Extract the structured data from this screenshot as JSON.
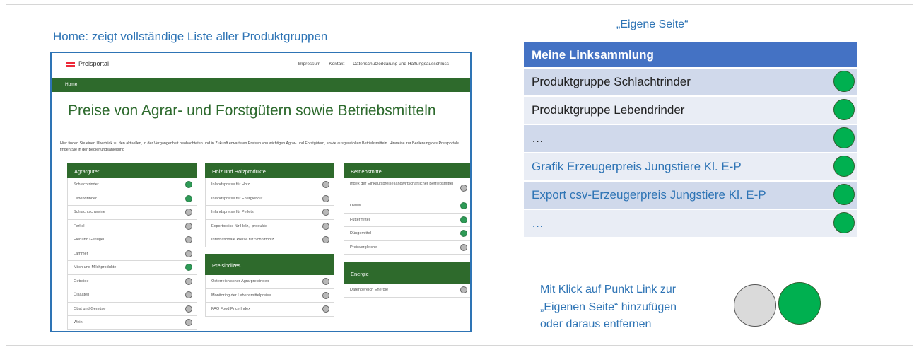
{
  "home_caption": "Home: zeigt vollständige Liste aller Produktgruppen",
  "eigene_caption": "„Eigene Seite“",
  "site": {
    "logo": "Preisportal",
    "nav": [
      "Impressum",
      "Kontakt",
      "Datenschutzerklärung und Haftungsausschluss"
    ],
    "breadcrumb": "Home",
    "title": "Preise von Agrar- und Forstgütern sowie Betriebsmitteln",
    "intro": "Hier finden Sie einen Überblick zu den aktuellen, in der Vergangenheit beobachteten und in Zukunft erwarteten Preisen von wichtigen Agrar- und Forstgütern, sowie ausgewählten Betriebsmitteln. Hinweise zur Bedienung des Preisportals finden Sie in der Bedienungsanleitung",
    "flag_colors": [
      "#ed2939",
      "#ffffff",
      "#ed2939"
    ],
    "boxes": {
      "agrar": {
        "title": "Agrargüter",
        "items": [
          {
            "label": "Schlachtrinder",
            "state": "green"
          },
          {
            "label": "Lebendrinder",
            "state": "green"
          },
          {
            "label": "Schlachtschweine",
            "state": "grey"
          },
          {
            "label": "Ferkel",
            "state": "grey"
          },
          {
            "label": "Eier und Geflügel",
            "state": "grey"
          },
          {
            "label": "Lämmer",
            "state": "grey"
          },
          {
            "label": "Milch und Milchprodukte",
            "state": "green"
          },
          {
            "label": "Getreide",
            "state": "grey"
          },
          {
            "label": "Ölsaaten",
            "state": "grey"
          },
          {
            "label": "Obst und Gemüse",
            "state": "grey"
          },
          {
            "label": "Wein",
            "state": "grey"
          }
        ]
      },
      "holz": {
        "title": "Holz und Holzprodukte",
        "items": [
          {
            "label": "Inlandspreise für Holz",
            "state": "grey"
          },
          {
            "label": "Inlandspreise für Energieholz",
            "state": "grey"
          },
          {
            "label": "Inlandspreise für Pellets",
            "state": "grey"
          },
          {
            "label": "Exportpreise für Holz, -produkte",
            "state": "grey"
          },
          {
            "label": "Internationale Preise für Schnittholz",
            "state": "grey"
          }
        ]
      },
      "preisindizes": {
        "title": "Preisindizes",
        "items": [
          {
            "label": "Österreichischer Agrarpreisindex",
            "state": "grey"
          },
          {
            "label": "Monitoring der Lebensmittelpreise",
            "state": "grey"
          },
          {
            "label": "FAO Food Price Index",
            "state": "grey"
          }
        ]
      },
      "betriebsmittel": {
        "title": "Betriebsmittel",
        "items": [
          {
            "label": "Index der Einkaufspreise landwirtschaftlicher Betriebsmittel",
            "state": "grey"
          },
          {
            "label": "Diesel",
            "state": "green"
          },
          {
            "label": "Futtermittel",
            "state": "green"
          },
          {
            "label": "Düngemittel",
            "state": "green"
          },
          {
            "label": "Preisvergleiche",
            "state": "grey"
          }
        ]
      },
      "energie": {
        "title": "Energie",
        "items": [
          {
            "label": "Datenbereich Energie",
            "state": "grey"
          }
        ]
      }
    }
  },
  "links": {
    "heading": "Meine Linksammlung",
    "items": [
      {
        "label": "Produktgruppe Schlachtrinder",
        "shade": "dark",
        "color": "black"
      },
      {
        "label": "Produktgruppe Lebendrinder",
        "shade": "light",
        "color": "black"
      },
      {
        "label": "…",
        "shade": "dark",
        "color": "black"
      },
      {
        "label": "Grafik Erzeugerpreis Jungstiere Kl. E-P",
        "shade": "light",
        "color": "blue"
      },
      {
        "label": "Export csv-Erzeugerpreis Jungstiere Kl. E-P",
        "shade": "dark",
        "color": "blue"
      },
      {
        "label": "…",
        "shade": "light",
        "color": "blue"
      }
    ]
  },
  "legend_text": [
    "Mit Klick auf Punkt Link zur",
    "„Eigenen Seite“ hinzufügen",
    "oder daraus entfernen"
  ],
  "colors": {
    "site_green": "#2e6a2c",
    "accent_blue": "#2e74b5",
    "header_blue": "#4472c4",
    "dot_green": "#00b050"
  }
}
